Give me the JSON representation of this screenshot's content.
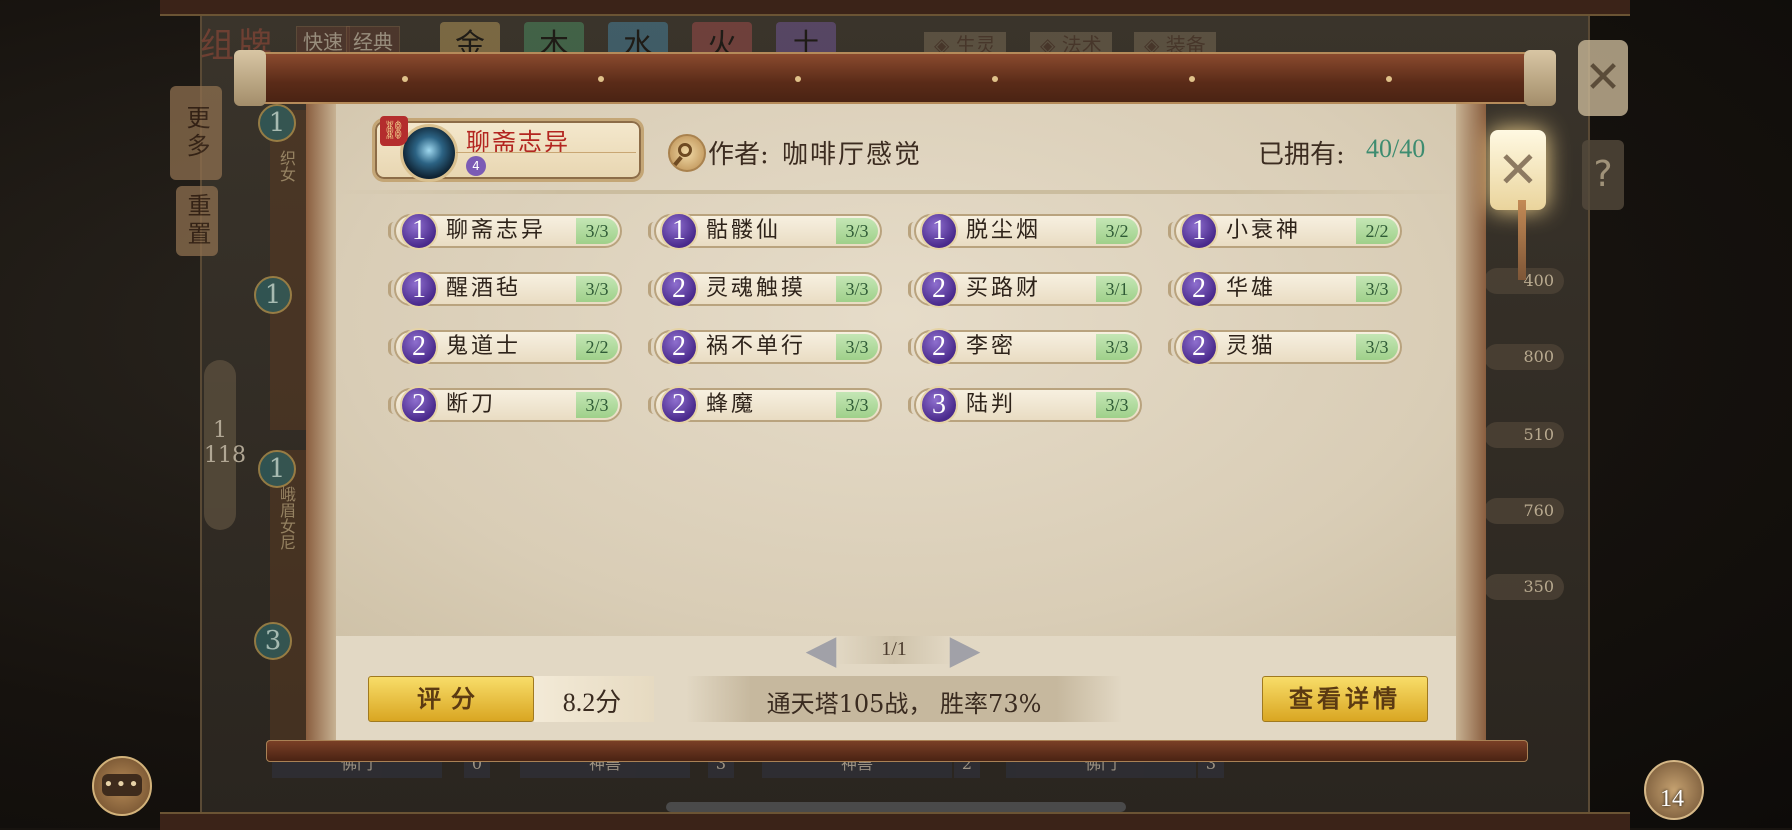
{
  "background": {
    "title": "组牌",
    "mode_tabs": [
      "快速",
      "经典"
    ],
    "elements": [
      {
        "label": "金",
        "color": "#c9a760"
      },
      {
        "label": "木",
        "color": "#4f9a6a"
      },
      {
        "label": "水",
        "color": "#4a8fb0"
      },
      {
        "label": "火",
        "color": "#b05050"
      },
      {
        "label": "土",
        "color": "#7a5ca8"
      }
    ],
    "categories": [
      "◈ 生灵",
      "◈ 法术",
      "◈ 装备"
    ],
    "side_tabs": [
      "更多",
      "重置"
    ],
    "pager": {
      "current": "1",
      "total": "118"
    },
    "right_values": [
      "400",
      "800",
      "510",
      "760",
      "350"
    ],
    "bottom_tags": [
      "佛门",
      "0",
      "神兽",
      "3",
      "神兽",
      "2",
      "佛门",
      "3"
    ],
    "left_badges": [
      "1",
      "1",
      "1",
      "3"
    ],
    "left_card_texts": [
      "织女",
      "峨眉女尼"
    ]
  },
  "dialog": {
    "deck_name": "聊斋志异",
    "deck_sub_icon": "4",
    "author_label": "作者:",
    "author_name": "咖啡厅感觉",
    "owned_label": "已拥有:",
    "owned_value": "40/40",
    "close_symbol": "✕",
    "cards": [
      {
        "cost": "1",
        "name": "聊斋志异",
        "count": "3/3"
      },
      {
        "cost": "1",
        "name": "骷髅仙",
        "count": "3/3"
      },
      {
        "cost": "1",
        "name": "脱尘烟",
        "count": "3/2"
      },
      {
        "cost": "1",
        "name": "小衰神",
        "count": "2/2"
      },
      {
        "cost": "1",
        "name": "醒酒毡",
        "count": "3/3"
      },
      {
        "cost": "2",
        "name": "灵魂触摸",
        "count": "3/3"
      },
      {
        "cost": "2",
        "name": "买路财",
        "count": "3/1"
      },
      {
        "cost": "2",
        "name": "华雄",
        "count": "3/3"
      },
      {
        "cost": "2",
        "name": "鬼道士",
        "count": "2/2"
      },
      {
        "cost": "2",
        "name": "祸不单行",
        "count": "3/3"
      },
      {
        "cost": "2",
        "name": "李密",
        "count": "3/3"
      },
      {
        "cost": "2",
        "name": "灵猫",
        "count": "3/3"
      },
      {
        "cost": "2",
        "name": "断刀",
        "count": "3/3"
      },
      {
        "cost": "2",
        "name": "蜂魔",
        "count": "3/3"
      },
      {
        "cost": "3",
        "name": "陆判",
        "count": "3/3"
      }
    ],
    "page_indicator": "1/1",
    "prev_symbol": "◀",
    "next_symbol": "▶",
    "rating_label": "评分",
    "score": "8.2分",
    "stats": "通天塔105战， 胜率73%",
    "details_label": "查看详情"
  },
  "widgets": {
    "chat_symbol": "•••",
    "count": "14",
    "help_symbol": "?",
    "top_close_symbol": "✕"
  }
}
